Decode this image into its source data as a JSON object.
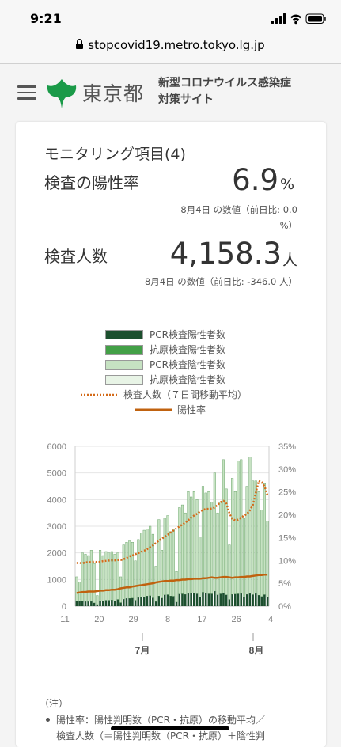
{
  "status": {
    "time": "9:21"
  },
  "browser": {
    "url": "stopcovid19.metro.tokyo.lg.jp"
  },
  "header": {
    "logo_text": "東京都",
    "site_title_1": "新型コロナウイルス感染症",
    "site_title_2": "対策サイト"
  },
  "card": {
    "title": "モニタリング項目(4)",
    "metric1": {
      "label": "検査の陽性率",
      "value": "6.9",
      "unit": "%",
      "note_1": "8月4日 の数値（前日比: 0.0",
      "note_2": "%）"
    },
    "metric2": {
      "label": "検査人数",
      "value": "4,158.3",
      "unit": "人",
      "note": "8月4日 の数値（前日比: -346.0 人）"
    },
    "legend": [
      {
        "label": "PCR検査陽性者数",
        "color": "#1c4f2e"
      },
      {
        "label": "抗原検査陽性者数",
        "color": "#43a047"
      },
      {
        "label": "PCR検査陰性者数",
        "color": "#c6e2c2"
      },
      {
        "label": "抗原検査陰性者数",
        "color": "#e8f4e6"
      },
      {
        "label": "検査人数（７日間移動平均）",
        "color": "#d46a18"
      },
      {
        "label": "陽性率",
        "color": "#c0620f"
      }
    ],
    "notes_head": "（注）",
    "notes_1": "陽性率：陽性判明数（PCR・抗原）の移動平均／",
    "notes_2": "検査人数（＝陽性判明数（PCR・抗原）＋陰性判"
  },
  "chart_data": {
    "type": "bar",
    "x_tick_labels": [
      "11",
      "20",
      "29",
      "8",
      "17",
      "26",
      "4"
    ],
    "month_labels": [
      "7月",
      "8月"
    ],
    "y_left": {
      "ticks": [
        "0",
        "1000",
        "2000",
        "3000",
        "4000",
        "5000",
        "6000"
      ],
      "lim": [
        0,
        6000
      ]
    },
    "y_right": {
      "ticks": [
        "0%",
        "5%",
        "10%",
        "15%",
        "20%",
        "25%",
        "30%",
        "35%"
      ],
      "lim": [
        0,
        35
      ]
    },
    "total_tests": [
      1100,
      900,
      2000,
      1950,
      1900,
      2100,
      1600,
      400,
      2100,
      1900,
      2050,
      2000,
      2050,
      1950,
      2000,
      1100,
      2300,
      2400,
      2450,
      2400,
      1700,
      2500,
      2750,
      2850,
      2900,
      3000,
      2700,
      1500,
      3250,
      2100,
      3300,
      3400,
      2800,
      2900,
      1300,
      3700,
      3800,
      3500,
      4300,
      4100,
      4300,
      4000,
      2600,
      4500,
      4250,
      4300,
      3900,
      5000,
      3500,
      3900,
      5500,
      4400,
      2300,
      4800,
      4300,
      5450,
      5500,
      3300,
      4500,
      5600,
      4700,
      4700,
      4300,
      3600,
      4600,
      3200
    ],
    "positive": [
      200,
      200,
      180,
      170,
      170,
      175,
      120,
      60,
      200,
      180,
      220,
      220,
      230,
      200,
      250,
      130,
      260,
      290,
      290,
      300,
      220,
      320,
      350,
      350,
      380,
      390,
      310,
      170,
      380,
      300,
      420,
      430,
      380,
      370,
      150,
      450,
      460,
      440,
      470,
      480,
      480,
      460,
      340,
      520,
      480,
      460,
      460,
      560,
      420,
      460,
      500,
      420,
      250,
      440,
      450,
      460,
      470,
      330,
      440,
      470,
      430,
      470,
      410,
      360,
      430,
      330
    ],
    "moving_avg_tests": [
      1620,
      1620,
      1610,
      1640,
      1650,
      1650,
      1670,
      1650,
      1660,
      1690,
      1700,
      1710,
      1720,
      1720,
      1730,
      1730,
      1760,
      1810,
      1870,
      1900,
      1950,
      1990,
      2040,
      2080,
      2140,
      2210,
      2280,
      2370,
      2460,
      2530,
      2610,
      2680,
      2760,
      2840,
      2920,
      2990,
      3060,
      3140,
      3220,
      3320,
      3400,
      3470,
      3550,
      3610,
      3650,
      3650,
      3660,
      3700,
      3800,
      3900,
      3950,
      3850,
      3500,
      3280,
      3220,
      3250,
      3320,
      3400,
      3460,
      3600,
      3800,
      4250,
      4700,
      4650,
      4500,
      4158
    ],
    "positivity_rate": [
      2.9,
      3.0,
      3.1,
      3.1,
      3.2,
      3.2,
      3.2,
      3.3,
      3.4,
      3.4,
      3.5,
      3.5,
      3.6,
      3.6,
      3.7,
      3.9,
      4.0,
      4.1,
      4.1,
      4.3,
      4.4,
      4.5,
      4.6,
      4.7,
      4.8,
      4.9,
      5.0,
      5.2,
      5.3,
      5.4,
      5.5,
      5.5,
      5.6,
      5.6,
      5.7,
      5.7,
      5.8,
      5.8,
      5.9,
      5.9,
      6.0,
      6.0,
      6.0,
      6.1,
      6.1,
      6.2,
      6.3,
      6.2,
      6.2,
      6.3,
      6.4,
      6.4,
      6.3,
      6.2,
      6.3,
      6.3,
      6.4,
      6.4,
      6.5,
      6.5,
      6.6,
      6.7,
      6.8,
      6.8,
      6.9,
      6.9
    ]
  }
}
